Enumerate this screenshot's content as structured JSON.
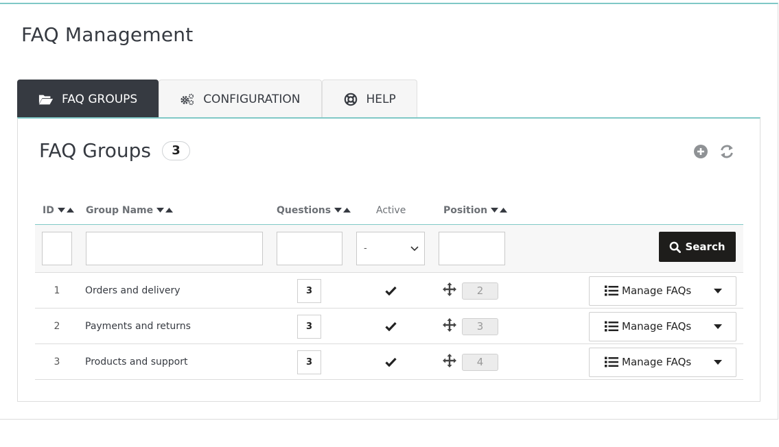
{
  "page": {
    "title": "FAQ Management"
  },
  "tabs": [
    {
      "label": "FAQ GROUPS",
      "icon": "folder-open-icon",
      "active": true
    },
    {
      "label": "CONFIGURATION",
      "icon": "cogs-icon",
      "active": false
    },
    {
      "label": "HELP",
      "icon": "life-ring-icon",
      "active": false
    }
  ],
  "panel": {
    "title": "FAQ Groups",
    "count": "3",
    "tools": [
      "add-icon",
      "refresh-icon"
    ]
  },
  "table": {
    "headers": {
      "id": "ID",
      "group_name": "Group Name",
      "questions": "Questions",
      "active": "Active",
      "position": "Position"
    },
    "filters": {
      "id": "",
      "group_name": "",
      "questions": "",
      "active_selected": "-",
      "position": ""
    },
    "search_label": "Search",
    "rows": [
      {
        "id": "1",
        "name": "Orders and delivery",
        "questions": "3",
        "position": "2",
        "action": "Manage FAQs"
      },
      {
        "id": "2",
        "name": "Payments and returns",
        "questions": "3",
        "position": "3",
        "action": "Manage FAQs"
      },
      {
        "id": "3",
        "name": "Products and support",
        "questions": "3",
        "position": "4",
        "action": "Manage FAQs"
      }
    ]
  },
  "colors": {
    "accent": "#7fc8c6",
    "active_tab": "#363a41",
    "search_button": "#1e1d1b"
  }
}
